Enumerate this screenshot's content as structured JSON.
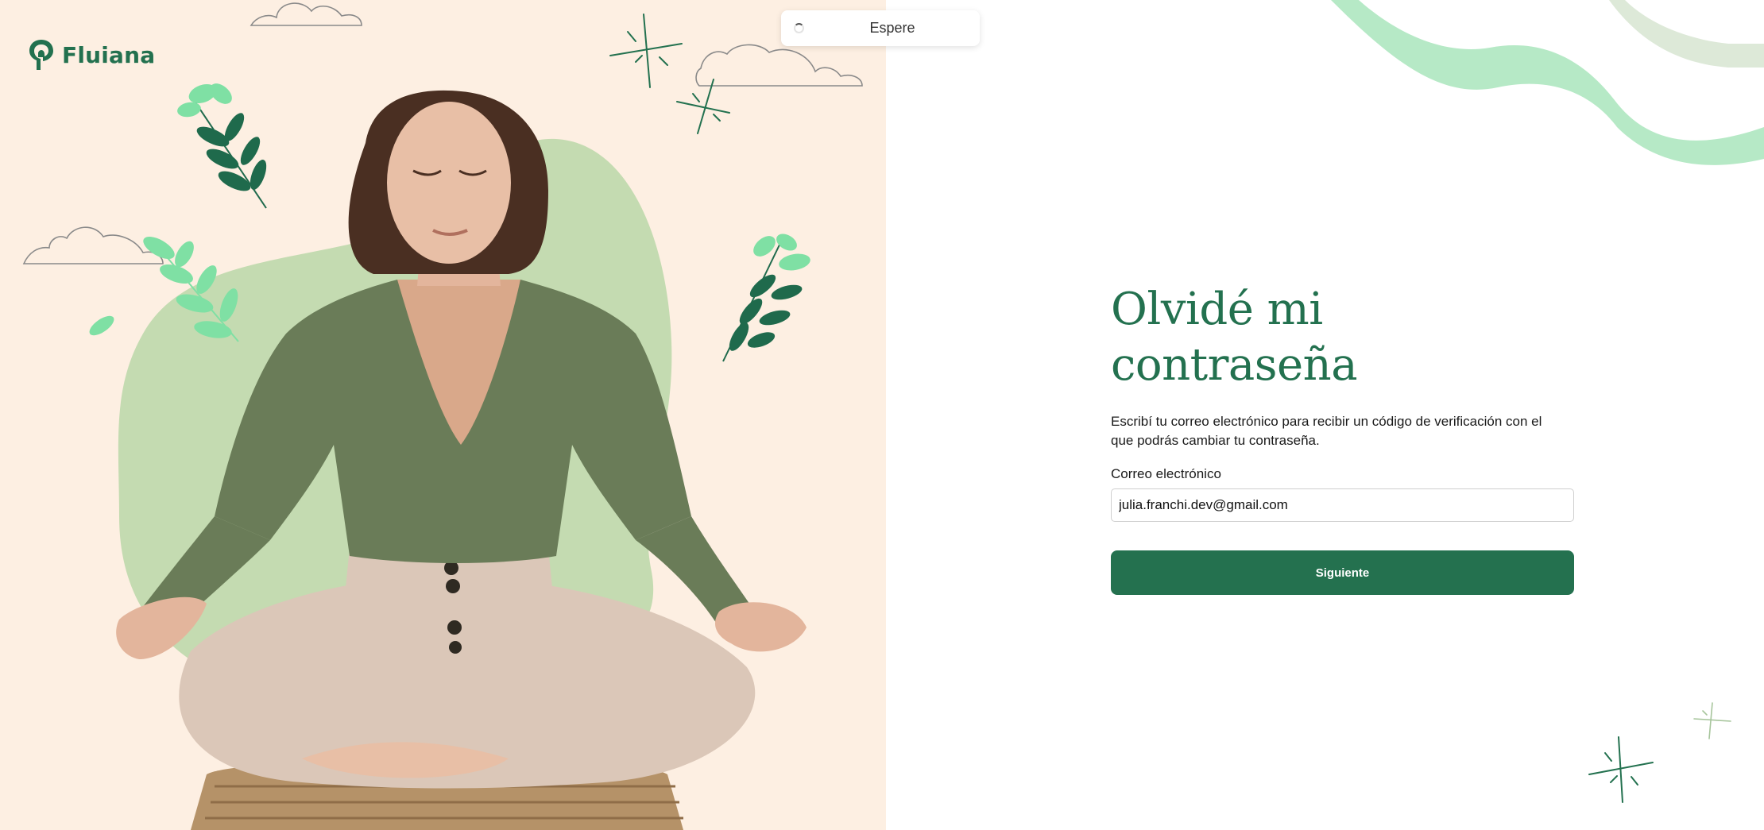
{
  "brand": {
    "name": "Fluiana",
    "logo_icon": "tree-pin-icon",
    "color": "#23714f"
  },
  "toast": {
    "text": "Espere",
    "icon": "spinner-icon"
  },
  "form": {
    "title": "Olvidé mi contraseña",
    "description": "Escribí tu correo electrónico para recibir un código de verificación con el que podrás cambiar tu contraseña.",
    "email_label": "Correo electrónico",
    "email_value": "julia.franchi.dev@gmail.com",
    "submit_label": "Siguiente"
  },
  "colors": {
    "accent": "#23714f",
    "panel_bg": "#fdefe2",
    "blob": "#c4dbb1",
    "leaf_light": "#7fe0a4",
    "leaf_dark": "#1f6a4c",
    "wave": "#b6e9c6"
  }
}
